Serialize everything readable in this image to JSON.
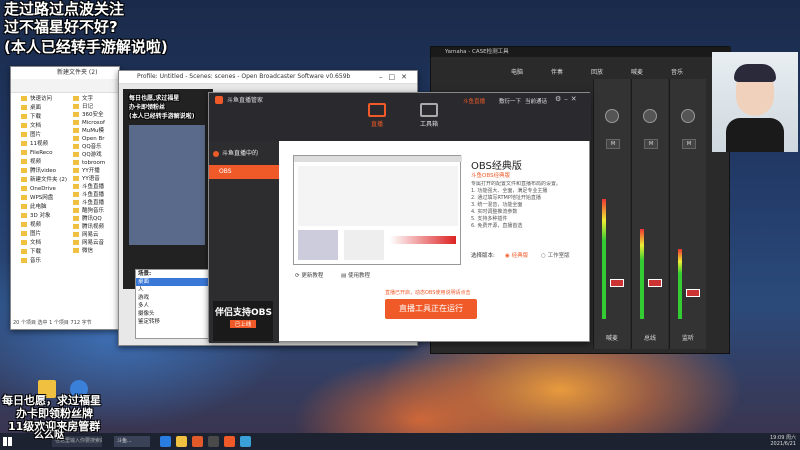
{
  "overlay": {
    "line1": "走过路过点波关注",
    "line2": "过不福星好不好?",
    "line3": "(本人已经转手游解说啦)",
    "bottom1": "每日也愿，求过福星",
    "bottom2": "办卡即领粉丝牌",
    "bottom3": "11级欢迎来房管群",
    "bottom4": "么么哒"
  },
  "explorer": {
    "tab": "新建文件夹 (2)",
    "sidebar": [
      "快速访问",
      "桌面",
      "下载",
      "文档",
      "图片",
      "11视频",
      "FileReco",
      "视频",
      "腾讯video",
      "新建文件夹 (2)",
      "OneDrive",
      "WPS网盘",
      "此电脑",
      "3D 对象",
      "视频",
      "图片",
      "文档",
      "下载",
      "音乐"
    ],
    "files": [
      "文字",
      "日记",
      "360安全",
      "Microsof",
      "MuMu模",
      "Open Br",
      "QQ音乐",
      "QQ游戏",
      "tobroom",
      "YY开播",
      "YY语音",
      "斗鱼直播",
      "斗鱼直播",
      "斗鱼直播",
      "酷狗音乐",
      "腾讯QQ",
      "腾讯视频",
      "网易云",
      "网易云音",
      "微信"
    ],
    "status": "20 个项目  选中 1 个项目  712 字节"
  },
  "obs_window_title": "Profile: Untitled - Scenes: scenes - Open Broadcaster Software v0.659b",
  "obs_overlay_small": [
    "每日也愿,求过福星",
    "办卡即领粉丝",
    "(本人已经转手游解说啦)"
  ],
  "scene_list": {
    "title": "场景:",
    "items": [
      "桌面",
      "人",
      "游戏",
      "多人",
      "摄像头",
      "鉴定转移"
    ]
  },
  "mixer": {
    "title": "Yamaha - CASE检测工具",
    "tabs": [
      "电脑",
      "伴奏",
      "回放",
      "喊麦",
      "音乐"
    ],
    "channels": [
      "电脑",
      "伴奏",
      "回放",
      "喊麦",
      "音乐",
      "总线",
      "监听"
    ],
    "bottom_labels": [
      "喊麦",
      "总线",
      "监听"
    ]
  },
  "douyu": {
    "title": "斗鱼直播管家",
    "tabs": [
      "直播",
      "工具箱"
    ],
    "user": "斗鱼直播",
    "header_links": [
      "敷衍一下",
      "当前通话"
    ],
    "side_items": [
      "斗鱼直播中的",
      "OBS"
    ],
    "promo": "伴侣支持OBS",
    "promo_sub": "已上线",
    "obs_title": "OBS经典版",
    "obs_subtitle": "斗鱼OBS经典版",
    "obs_desc": [
      "专属打开的配置文件和直播布局的设置。",
      "1. 功能强大、全面，满足专业主播",
      "2. 通过填写RTMP地址开始直播",
      "3. 统一混音，功能全面",
      "4. 实时调整推流参数",
      "5. 支持多种插件",
      "6. 免费开源，直播首选"
    ],
    "version_label": "选择版本:",
    "version_options": [
      "经典版",
      "工作室版"
    ],
    "link1": "更新教程",
    "link2": "使用教程",
    "notice": "直播已开启，动态OBS使用说明请点击",
    "start_button": "直播工具正在运行"
  },
  "taskbar": {
    "search_placeholder": "在这里输入你要搜索的内容",
    "item1": "斗鱼...",
    "time": "19:09 周六",
    "date": "2021/6/21"
  }
}
